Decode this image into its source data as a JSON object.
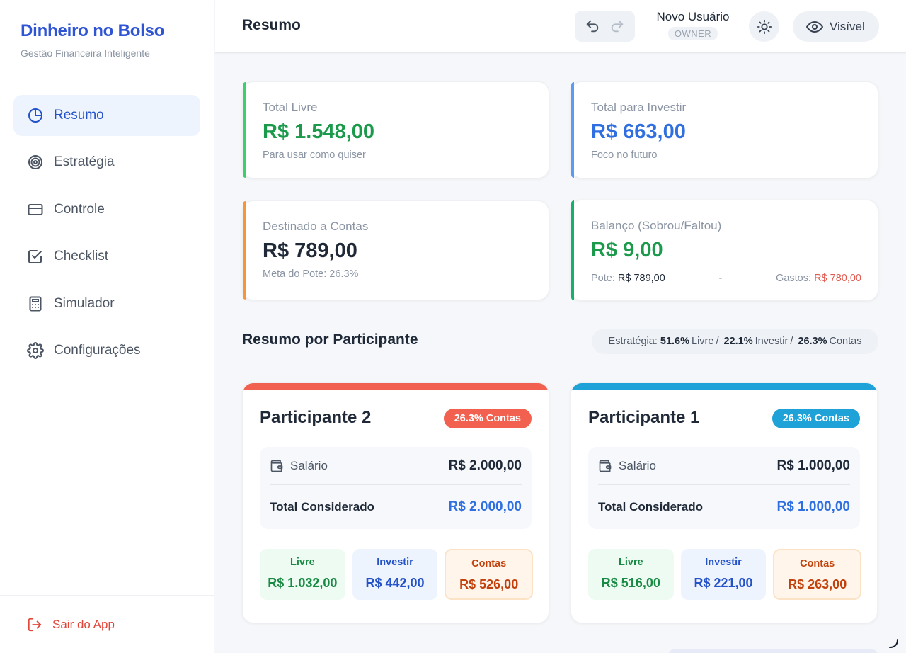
{
  "brand": {
    "title": "Dinheiro no Bolso",
    "subtitle": "Gestão Financeira Inteligente"
  },
  "sidebar": {
    "items": [
      {
        "label": "Resumo",
        "icon": "pie-chart-icon",
        "active": true
      },
      {
        "label": "Estratégia",
        "icon": "target-icon",
        "active": false
      },
      {
        "label": "Controle",
        "icon": "credit-card-icon",
        "active": false
      },
      {
        "label": "Checklist",
        "icon": "check-square-icon",
        "active": false
      },
      {
        "label": "Simulador",
        "icon": "calculator-icon",
        "active": false
      },
      {
        "label": "Configurações",
        "icon": "gear-icon",
        "active": false
      }
    ],
    "logout_label": "Sair do App"
  },
  "header": {
    "title": "Resumo",
    "user_name": "Novo Usuário",
    "user_role": "OWNER",
    "visibility_label": "Visível"
  },
  "summary": {
    "livre": {
      "label": "Total Livre",
      "value": "R$ 1.548,00",
      "note": "Para usar como quiser",
      "color": "#1a9a4a"
    },
    "investir": {
      "label": "Total para Investir",
      "value": "R$ 663,00",
      "note": "Foco no futuro",
      "color": "#2f6fe0"
    },
    "contas": {
      "label": "Destinado a Contas",
      "value": "R$ 789,00",
      "note": "Meta do Pote: 26.3%",
      "color": "#1f2937"
    },
    "balanco": {
      "label": "Balanço (Sobrou/Faltou)",
      "value": "R$ 9,00",
      "color": "#1a9a4a",
      "pote_label": "Pote:",
      "pote_value": "R$ 789,00",
      "dash": "-",
      "gastos_label": "Gastos:",
      "gastos_value": "R$ 780,00"
    }
  },
  "section": {
    "title": "Resumo por Participante",
    "strategy_prefix": "Estratégia:",
    "livre_pct": "51.6%",
    "livre_word": "Livre",
    "invest_pct": "22.1%",
    "invest_word": "Investir",
    "contas_pct": "26.3%",
    "contas_word": "Contas",
    "slash": "/"
  },
  "participants": [
    {
      "name": "Participante 2",
      "badge": "26.3% Contas",
      "color": "#f2604f",
      "income_label": "Salário",
      "income_value": "R$ 2.000,00",
      "total_label": "Total Considerado",
      "total_value": "R$ 2.000,00",
      "livre_label": "Livre",
      "livre_value": "R$ 1.032,00",
      "invest_label": "Investir",
      "invest_value": "R$ 442,00",
      "contas_label": "Contas",
      "contas_value": "R$ 526,00"
    },
    {
      "name": "Participante 1",
      "badge": "26.3% Contas",
      "color": "#1ea2d8",
      "income_label": "Salário",
      "income_value": "R$ 1.000,00",
      "total_label": "Total Considerado",
      "total_value": "R$ 1.000,00",
      "livre_label": "Livre",
      "livre_value": "R$ 516,00",
      "invest_label": "Investir",
      "invest_value": "R$ 221,00",
      "contas_label": "Contas",
      "contas_value": "R$ 263,00"
    }
  ]
}
